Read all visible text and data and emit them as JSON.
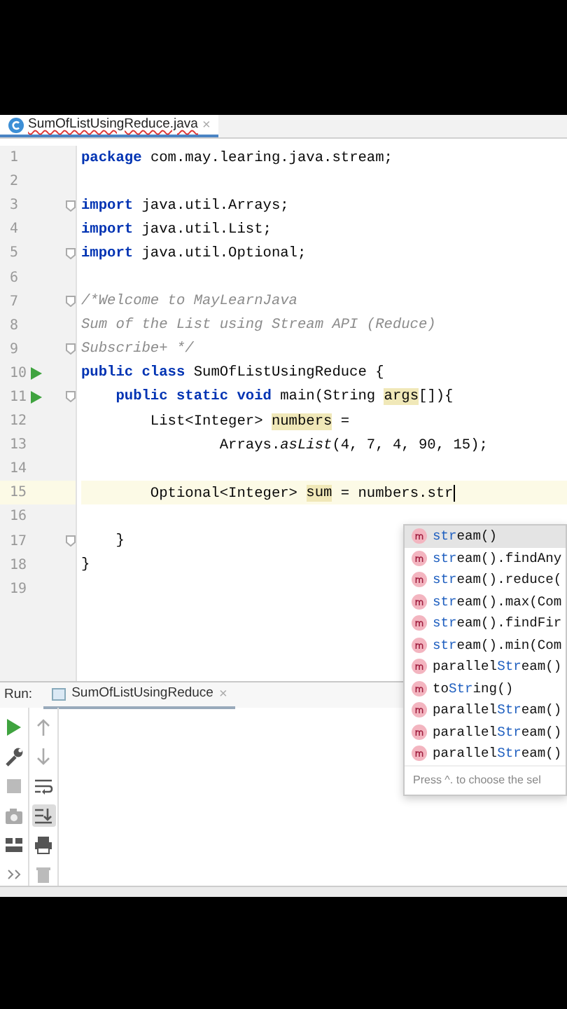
{
  "editor_tab": {
    "title": "SumOfListUsingReduce.java",
    "close": "×",
    "selected": true
  },
  "lines": [
    {
      "number": "1",
      "run": false,
      "fold": false,
      "current": false,
      "tokens": [
        {
          "text": "package",
          "kind": "keyword"
        },
        {
          "text": " com.may.learing.java.stream;",
          "kind": "plain"
        }
      ]
    },
    {
      "number": "2",
      "run": false,
      "fold": false,
      "current": false
    },
    {
      "number": "3",
      "run": false,
      "fold": true,
      "current": false,
      "tokens": [
        {
          "text": "import",
          "kind": "keyword"
        },
        {
          "text": " java.util.Arrays;",
          "kind": "plain"
        }
      ]
    },
    {
      "number": "4",
      "run": false,
      "fold": false,
      "current": false,
      "tokens": [
        {
          "text": "import",
          "kind": "keyword"
        },
        {
          "text": " java.util.List;",
          "kind": "plain"
        }
      ]
    },
    {
      "number": "5",
      "run": false,
      "fold": true,
      "current": false,
      "tokens": [
        {
          "text": "import",
          "kind": "keyword"
        },
        {
          "text": " java.util.Optional;",
          "kind": "plain"
        }
      ]
    },
    {
      "number": "6",
      "run": false,
      "fold": false,
      "current": false
    },
    {
      "number": "7",
      "run": false,
      "fold": true,
      "current": false,
      "tokens": [
        {
          "text": "/*Welcome to MayLearnJava",
          "kind": "comment"
        }
      ]
    },
    {
      "number": "8",
      "run": false,
      "fold": false,
      "current": false,
      "tokens": [
        {
          "text": "Sum of the List using Stream API (Reduce)",
          "kind": "comment"
        }
      ]
    },
    {
      "number": "9",
      "run": false,
      "fold": true,
      "current": false,
      "tokens": [
        {
          "text": "Subscribe+ */",
          "kind": "comment"
        }
      ]
    },
    {
      "number": "10",
      "run": true,
      "fold": false,
      "current": false,
      "tokens": [
        {
          "text": "public class",
          "kind": "keyword"
        },
        {
          "text": " SumOfListUsingReduce {",
          "kind": "plain"
        }
      ]
    },
    {
      "number": "11",
      "run": true,
      "fold": true,
      "current": false,
      "tokens": [
        {
          "text": "    public static void",
          "kind": "keyword"
        },
        {
          "text": " main(String ",
          "kind": "plain"
        },
        {
          "text": "args",
          "kind": "usage"
        },
        {
          "text": "[]){",
          "kind": "plain"
        }
      ]
    },
    {
      "number": "12",
      "run": false,
      "fold": false,
      "current": false,
      "tokens": [
        {
          "text": "        List<Integer> ",
          "kind": "plain"
        },
        {
          "text": "numbers",
          "kind": "usage"
        },
        {
          "text": " =",
          "kind": "plain"
        }
      ]
    },
    {
      "number": "13",
      "run": false,
      "fold": false,
      "current": false,
      "tokens": [
        {
          "text": "                Arrays.",
          "kind": "plain"
        },
        {
          "text": "asList",
          "kind": "static"
        },
        {
          "text": "(4, 7, 4, 90, 15);",
          "kind": "plain"
        }
      ]
    },
    {
      "number": "14",
      "run": false,
      "fold": false,
      "current": false
    },
    {
      "number": "15",
      "run": false,
      "fold": false,
      "current": true,
      "tokens": [
        {
          "text": "        Optional<Integer> ",
          "kind": "plain"
        },
        {
          "text": "sum",
          "kind": "usage"
        },
        {
          "text": " = numbers.str",
          "kind": "plain"
        }
      ]
    },
    {
      "number": "16",
      "run": false,
      "fold": false,
      "current": false
    },
    {
      "number": "17",
      "run": false,
      "fold": true,
      "current": false,
      "tokens": [
        {
          "text": "    }",
          "kind": "plain"
        }
      ]
    },
    {
      "number": "18",
      "run": false,
      "fold": false,
      "current": false,
      "tokens": [
        {
          "text": "}",
          "kind": "plain"
        }
      ]
    },
    {
      "number": "19",
      "run": false,
      "fold": false,
      "current": false
    }
  ],
  "completion": {
    "items": [
      {
        "selected": true,
        "parts": [
          {
            "text": "str",
            "match": true
          },
          {
            "text": "eam()",
            "match": false
          }
        ]
      },
      {
        "selected": false,
        "parts": [
          {
            "text": "str",
            "match": true
          },
          {
            "text": "eam().findAny",
            "match": false
          }
        ]
      },
      {
        "selected": false,
        "parts": [
          {
            "text": "str",
            "match": true
          },
          {
            "text": "eam().reduce(",
            "match": false
          }
        ]
      },
      {
        "selected": false,
        "parts": [
          {
            "text": "str",
            "match": true
          },
          {
            "text": "eam().max(Com",
            "match": false
          }
        ]
      },
      {
        "selected": false,
        "parts": [
          {
            "text": "str",
            "match": true
          },
          {
            "text": "eam().findFir",
            "match": false
          }
        ]
      },
      {
        "selected": false,
        "parts": [
          {
            "text": "str",
            "match": true
          },
          {
            "text": "eam().min(Com",
            "match": false
          }
        ]
      },
      {
        "selected": false,
        "parts": [
          {
            "text": "parallel",
            "match": false
          },
          {
            "text": "Str",
            "match": true
          },
          {
            "text": "eam()",
            "match": false
          }
        ]
      },
      {
        "selected": false,
        "parts": [
          {
            "text": "to",
            "match": false
          },
          {
            "text": "Str",
            "match": true
          },
          {
            "text": "ing()",
            "match": false
          }
        ]
      },
      {
        "selected": false,
        "parts": [
          {
            "text": "parallel",
            "match": false
          },
          {
            "text": "Str",
            "match": true
          },
          {
            "text": "eam()",
            "match": false
          }
        ]
      },
      {
        "selected": false,
        "parts": [
          {
            "text": "parallel",
            "match": false
          },
          {
            "text": "Str",
            "match": true
          },
          {
            "text": "eam()",
            "match": false
          }
        ]
      },
      {
        "selected": false,
        "parts": [
          {
            "text": "parallel",
            "match": false
          },
          {
            "text": "Str",
            "match": true
          },
          {
            "text": "eam()",
            "match": false
          }
        ]
      }
    ],
    "hint": "Press ^. to choose the sel"
  },
  "run_panel": {
    "label": "Run:",
    "tab": "SumOfListUsingReduce",
    "close": "×",
    "selected": true,
    "left_tools": [
      {
        "kind": "run",
        "selected": false
      },
      {
        "kind": "wrench",
        "selected": false
      },
      {
        "kind": "stop",
        "selected": false
      },
      {
        "kind": "camera",
        "selected": false
      },
      {
        "kind": "layout",
        "selected": false
      },
      {
        "kind": "more",
        "selected": false
      }
    ],
    "right_tools": [
      {
        "kind": "up",
        "selected": false
      },
      {
        "kind": "down",
        "selected": false
      },
      {
        "kind": "wrap",
        "selected": false
      },
      {
        "kind": "scroll-end",
        "selected": true
      },
      {
        "kind": "print",
        "selected": false
      },
      {
        "kind": "trash",
        "selected": false
      }
    ]
  }
}
